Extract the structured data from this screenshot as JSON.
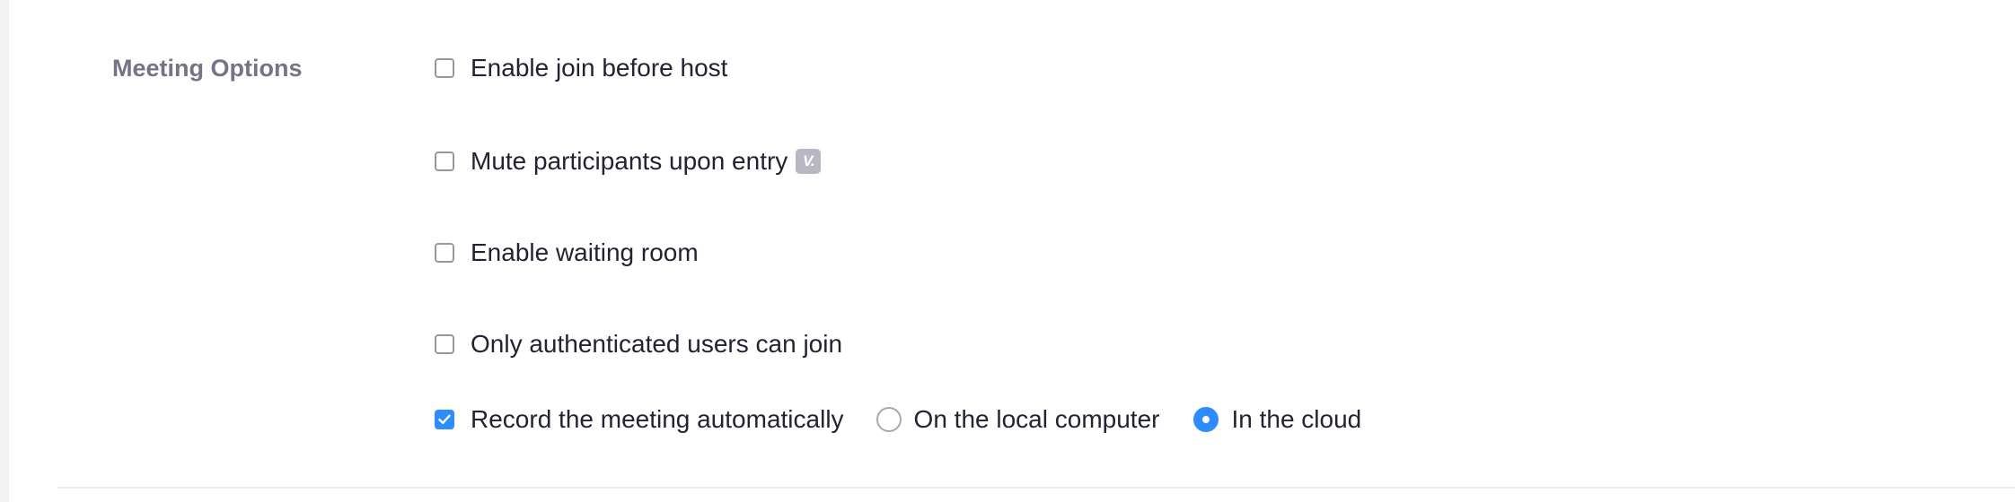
{
  "section": {
    "title": "Meeting Options"
  },
  "options": [
    {
      "label": "Enable join before host",
      "checked": false
    },
    {
      "label": "Mute participants upon entry",
      "checked": false,
      "badge": "V."
    },
    {
      "label": "Enable waiting room",
      "checked": false
    },
    {
      "label": "Only authenticated users can join",
      "checked": false
    },
    {
      "label": "Record the meeting automatically",
      "checked": true
    }
  ],
  "recording_location": {
    "choices": [
      {
        "label": "On the local computer",
        "selected": false
      },
      {
        "label": "In the cloud",
        "selected": true
      }
    ]
  },
  "colors": {
    "accent": "#2d8cff",
    "label_gray": "#747487",
    "text": "#232333"
  },
  "icons": {
    "checkmark": "check-icon",
    "badge": "vip-badge-icon"
  }
}
